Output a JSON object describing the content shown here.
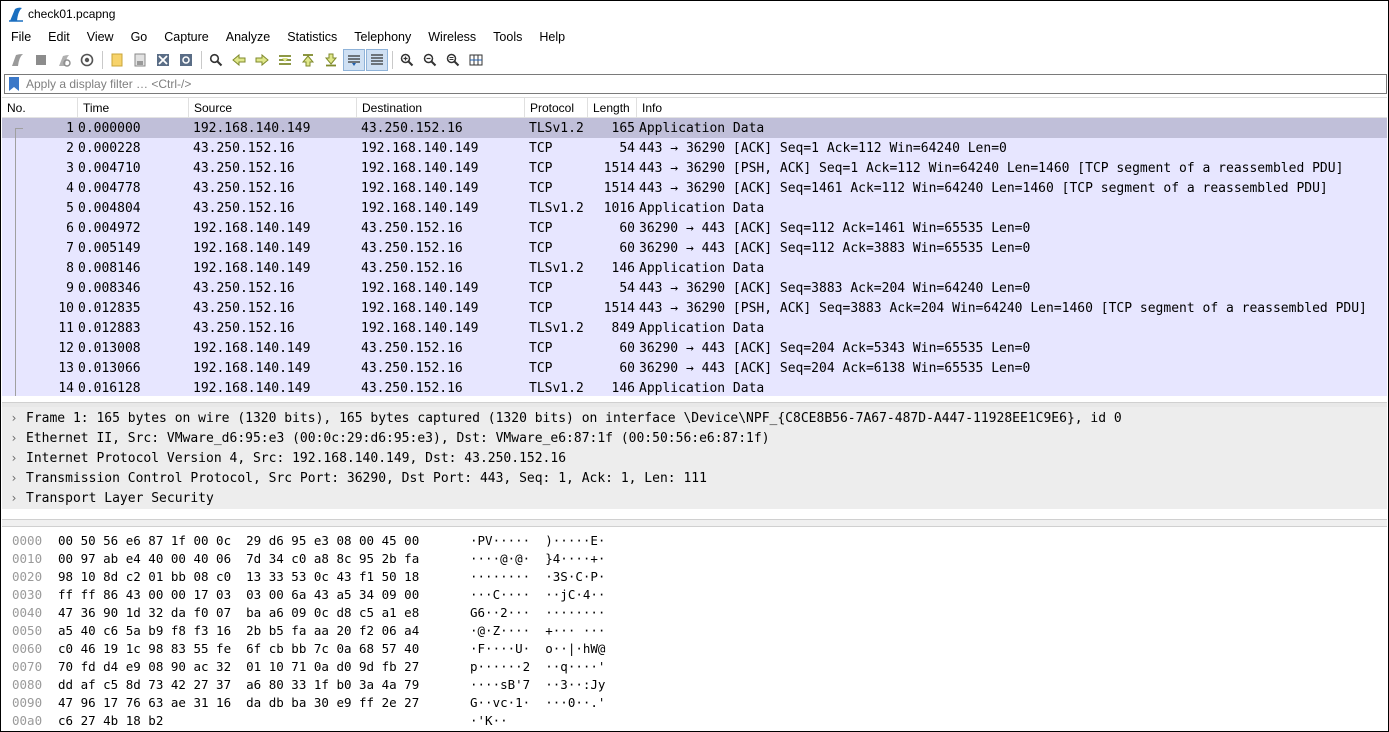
{
  "window": {
    "title": "check01.pcapng"
  },
  "menu": [
    "File",
    "Edit",
    "View",
    "Go",
    "Capture",
    "Analyze",
    "Statistics",
    "Telephony",
    "Wireless",
    "Tools",
    "Help"
  ],
  "toolbar": {
    "icons": [
      "start-capture-icon",
      "stop-capture-icon",
      "restart-capture-icon",
      "capture-options-icon",
      "open-file-icon",
      "save-file-icon",
      "close-file-icon",
      "reload-file-icon",
      "find-packet-icon",
      "go-back-icon",
      "go-forward-icon",
      "go-to-packet-icon",
      "go-first-icon",
      "go-last-icon",
      "auto-scroll-icon",
      "colorize-icon",
      "zoom-in-icon",
      "zoom-out-icon",
      "zoom-normal-icon",
      "resize-columns-icon"
    ]
  },
  "filter": {
    "placeholder": "Apply a display filter … <Ctrl-/>"
  },
  "columns": [
    "No.",
    "Time",
    "Source",
    "Destination",
    "Protocol",
    "Length",
    "Info"
  ],
  "packets": [
    {
      "no": "1",
      "time": "0.000000",
      "src": "192.168.140.149",
      "dst": "43.250.152.16",
      "proto": "TLSv1.2",
      "len": "165",
      "info": "Application Data"
    },
    {
      "no": "2",
      "time": "0.000228",
      "src": "43.250.152.16",
      "dst": "192.168.140.149",
      "proto": "TCP",
      "len": "54",
      "info": "443 → 36290 [ACK] Seq=1 Ack=112 Win=64240 Len=0"
    },
    {
      "no": "3",
      "time": "0.004710",
      "src": "43.250.152.16",
      "dst": "192.168.140.149",
      "proto": "TCP",
      "len": "1514",
      "info": "443 → 36290 [PSH, ACK] Seq=1 Ack=112 Win=64240 Len=1460 [TCP segment of a reassembled PDU]"
    },
    {
      "no": "4",
      "time": "0.004778",
      "src": "43.250.152.16",
      "dst": "192.168.140.149",
      "proto": "TCP",
      "len": "1514",
      "info": "443 → 36290 [ACK] Seq=1461 Ack=112 Win=64240 Len=1460 [TCP segment of a reassembled PDU]"
    },
    {
      "no": "5",
      "time": "0.004804",
      "src": "43.250.152.16",
      "dst": "192.168.140.149",
      "proto": "TLSv1.2",
      "len": "1016",
      "info": "Application Data"
    },
    {
      "no": "6",
      "time": "0.004972",
      "src": "192.168.140.149",
      "dst": "43.250.152.16",
      "proto": "TCP",
      "len": "60",
      "info": "36290 → 443 [ACK] Seq=112 Ack=1461 Win=65535 Len=0"
    },
    {
      "no": "7",
      "time": "0.005149",
      "src": "192.168.140.149",
      "dst": "43.250.152.16",
      "proto": "TCP",
      "len": "60",
      "info": "36290 → 443 [ACK] Seq=112 Ack=3883 Win=65535 Len=0"
    },
    {
      "no": "8",
      "time": "0.008146",
      "src": "192.168.140.149",
      "dst": "43.250.152.16",
      "proto": "TLSv1.2",
      "len": "146",
      "info": "Application Data"
    },
    {
      "no": "9",
      "time": "0.008346",
      "src": "43.250.152.16",
      "dst": "192.168.140.149",
      "proto": "TCP",
      "len": "54",
      "info": "443 → 36290 [ACK] Seq=3883 Ack=204 Win=64240 Len=0"
    },
    {
      "no": "10",
      "time": "0.012835",
      "src": "43.250.152.16",
      "dst": "192.168.140.149",
      "proto": "TCP",
      "len": "1514",
      "info": "443 → 36290 [PSH, ACK] Seq=3883 Ack=204 Win=64240 Len=1460 [TCP segment of a reassembled PDU]"
    },
    {
      "no": "11",
      "time": "0.012883",
      "src": "43.250.152.16",
      "dst": "192.168.140.149",
      "proto": "TLSv1.2",
      "len": "849",
      "info": "Application Data"
    },
    {
      "no": "12",
      "time": "0.013008",
      "src": "192.168.140.149",
      "dst": "43.250.152.16",
      "proto": "TCP",
      "len": "60",
      "info": "36290 → 443 [ACK] Seq=204 Ack=5343 Win=65535 Len=0"
    },
    {
      "no": "13",
      "time": "0.013066",
      "src": "192.168.140.149",
      "dst": "43.250.152.16",
      "proto": "TCP",
      "len": "60",
      "info": "36290 → 443 [ACK] Seq=204 Ack=6138 Win=65535 Len=0"
    },
    {
      "no": "14",
      "time": "0.016128",
      "src": "192.168.140.149",
      "dst": "43.250.152.16",
      "proto": "TLSv1.2",
      "len": "146",
      "info": "Application Data"
    }
  ],
  "details": [
    "Frame 1: 165 bytes on wire (1320 bits), 165 bytes captured (1320 bits) on interface \\Device\\NPF_{C8CE8B56-7A67-487D-A447-11928EE1C9E6}, id 0",
    "Ethernet II, Src: VMware_d6:95:e3 (00:0c:29:d6:95:e3), Dst: VMware_e6:87:1f (00:50:56:e6:87:1f)",
    "Internet Protocol Version 4, Src: 192.168.140.149, Dst: 43.250.152.16",
    "Transmission Control Protocol, Src Port: 36290, Dst Port: 443, Seq: 1, Ack: 1, Len: 111",
    "Transport Layer Security"
  ],
  "bytes": [
    {
      "off": "0000",
      "hex": "00 50 56 e6 87 1f 00 0c  29 d6 95 e3 08 00 45 00",
      "ascii": "·PV·····  )·····E·"
    },
    {
      "off": "0010",
      "hex": "00 97 ab e4 40 00 40 06  7d 34 c0 a8 8c 95 2b fa",
      "ascii": "····@·@·  }4····+·"
    },
    {
      "off": "0020",
      "hex": "98 10 8d c2 01 bb 08 c0  13 33 53 0c 43 f1 50 18",
      "ascii": "········  ·3S·C·P·"
    },
    {
      "off": "0030",
      "hex": "ff ff 86 43 00 00 17 03  03 00 6a 43 a5 34 09 00",
      "ascii": "···C····  ··jC·4··"
    },
    {
      "off": "0040",
      "hex": "47 36 90 1d 32 da f0 07  ba a6 09 0c d8 c5 a1 e8",
      "ascii": "G6··2···  ········"
    },
    {
      "off": "0050",
      "hex": "a5 40 c6 5a b9 f8 f3 16  2b b5 fa aa 20 f2 06 a4",
      "ascii": "·@·Z····  +··· ···"
    },
    {
      "off": "0060",
      "hex": "c0 46 19 1c 98 83 55 fe  6f cb bb 7c 0a 68 57 40",
      "ascii": "·F····U·  o··|·hW@"
    },
    {
      "off": "0070",
      "hex": "70 fd d4 e9 08 90 ac 32  01 10 71 0a d0 9d fb 27",
      "ascii": "p······2  ··q····'"
    },
    {
      "off": "0080",
      "hex": "dd af c5 8d 73 42 27 37  a6 80 33 1f b0 3a 4a 79",
      "ascii": "····sB'7  ··3··:Jy"
    },
    {
      "off": "0090",
      "hex": "47 96 17 76 63 ae 31 16  da db ba 30 e9 ff 2e 27",
      "ascii": "G··vc·1·  ···0··.'"
    },
    {
      "off": "00a0",
      "hex": "c6 27 4b 18 b2",
      "ascii": "·'K··"
    }
  ]
}
